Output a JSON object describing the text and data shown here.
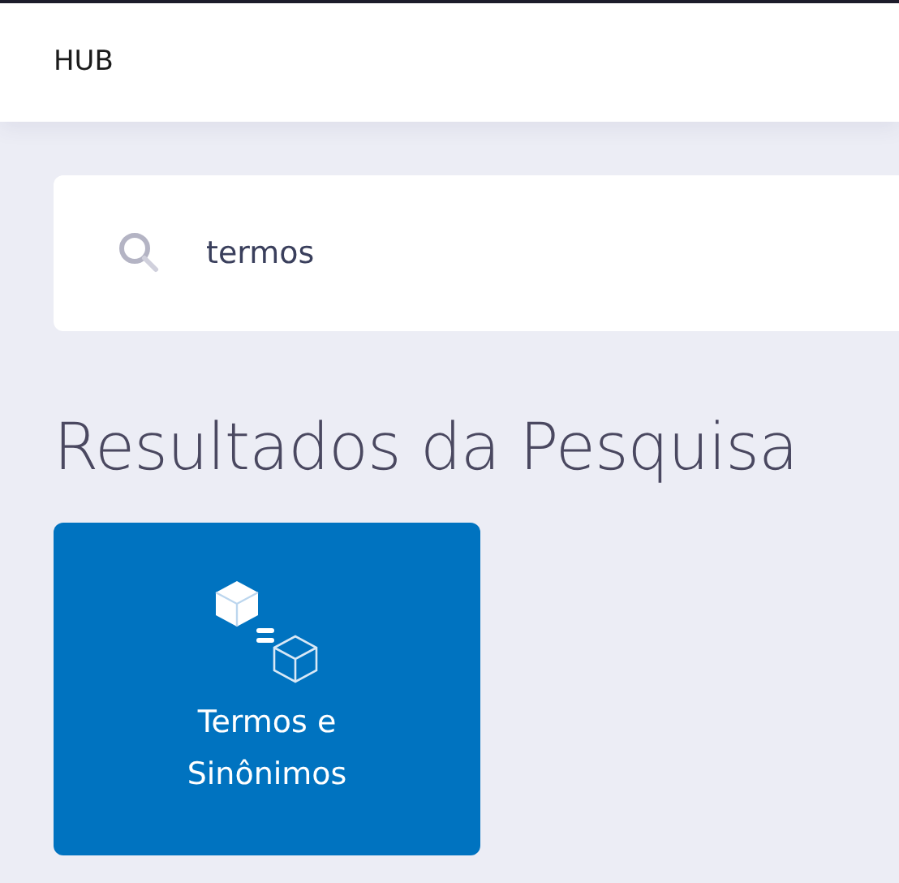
{
  "header": {
    "title": "HUB"
  },
  "search": {
    "value": "termos"
  },
  "results": {
    "heading": "Resultados da Pesquisa",
    "tiles": [
      {
        "label": "Termos e Sinônimos"
      }
    ]
  }
}
